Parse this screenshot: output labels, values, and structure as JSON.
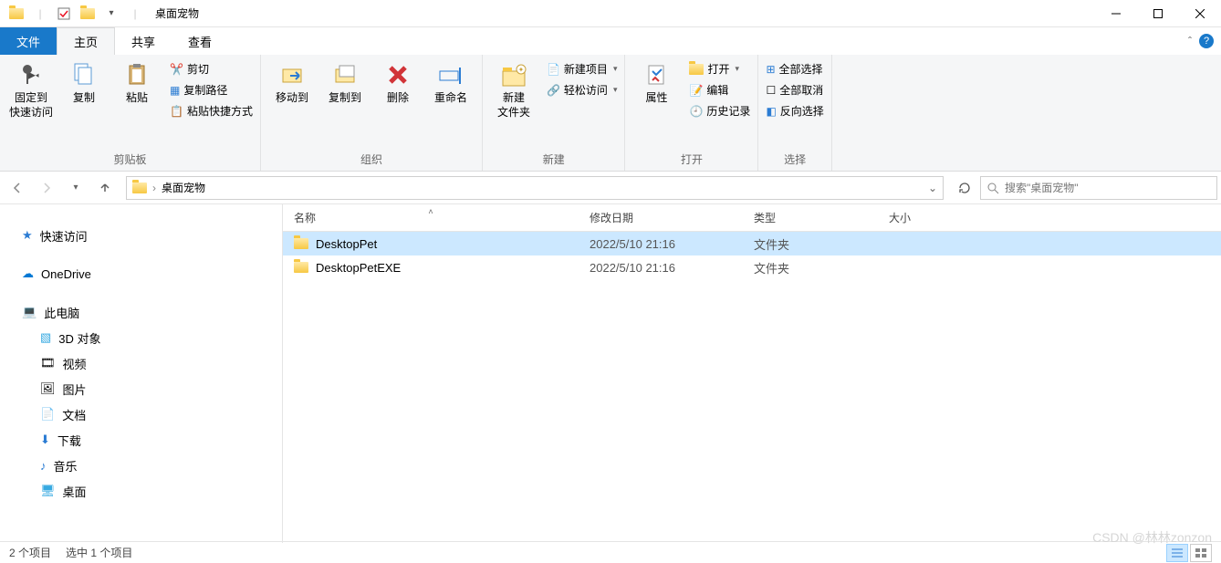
{
  "window": {
    "title": "桌面宠物"
  },
  "tabs": {
    "file": "文件",
    "home": "主页",
    "share": "共享",
    "view": "查看"
  },
  "ribbon": {
    "clipboard": {
      "label": "剪贴板",
      "pin": "固定到\n快速访问",
      "copy": "复制",
      "paste": "粘贴",
      "cut": "剪切",
      "copypath": "复制路径",
      "pasteshortcut": "粘贴快捷方式"
    },
    "organize": {
      "label": "组织",
      "moveto": "移动到",
      "copyto": "复制到",
      "delete": "删除",
      "rename": "重命名"
    },
    "new": {
      "label": "新建",
      "newfolder": "新建\n文件夹",
      "newitem": "新建项目",
      "easyaccess": "轻松访问"
    },
    "open": {
      "label": "打开",
      "properties": "属性",
      "open": "打开",
      "edit": "编辑",
      "history": "历史记录"
    },
    "select": {
      "label": "选择",
      "selectall": "全部选择",
      "selectnone": "全部取消",
      "invert": "反向选择"
    }
  },
  "breadcrumb": {
    "current": "桌面宠物"
  },
  "search": {
    "placeholder": "搜索\"桌面宠物\""
  },
  "navpane": {
    "quickaccess": "快速访问",
    "onedrive": "OneDrive",
    "thispc": "此电脑",
    "objects3d": "3D 对象",
    "videos": "视频",
    "pictures": "图片",
    "documents": "文档",
    "downloads": "下载",
    "music": "音乐",
    "desktop": "桌面"
  },
  "columns": {
    "name": "名称",
    "date": "修改日期",
    "type": "类型",
    "size": "大小"
  },
  "files": [
    {
      "name": "DesktopPet",
      "date": "2022/5/10 21:16",
      "type": "文件夹",
      "selected": true
    },
    {
      "name": "DesktopPetEXE",
      "date": "2022/5/10 21:16",
      "type": "文件夹",
      "selected": false
    }
  ],
  "status": {
    "count": "2 个项目",
    "selected": "选中 1 个项目"
  },
  "watermark": "CSDN @林林zonzon"
}
